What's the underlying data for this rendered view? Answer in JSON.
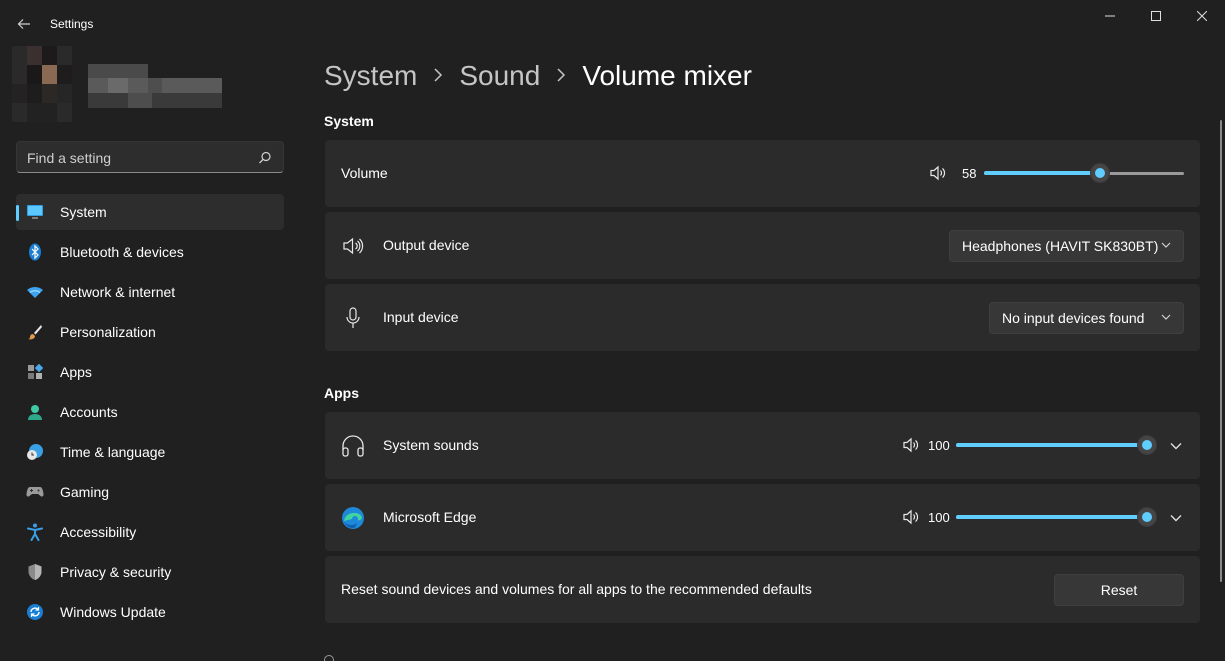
{
  "window": {
    "title": "Settings"
  },
  "search": {
    "placeholder": "Find a setting"
  },
  "sidebar": {
    "items": [
      {
        "label": "System",
        "icon": "monitor-icon",
        "active": true
      },
      {
        "label": "Bluetooth & devices",
        "icon": "bluetooth-icon"
      },
      {
        "label": "Network & internet",
        "icon": "wifi-icon"
      },
      {
        "label": "Personalization",
        "icon": "brush-icon"
      },
      {
        "label": "Apps",
        "icon": "apps-icon"
      },
      {
        "label": "Accounts",
        "icon": "person-icon"
      },
      {
        "label": "Time & language",
        "icon": "globe-clock-icon"
      },
      {
        "label": "Gaming",
        "icon": "gamepad-icon"
      },
      {
        "label": "Accessibility",
        "icon": "accessibility-icon"
      },
      {
        "label": "Privacy & security",
        "icon": "shield-icon"
      },
      {
        "label": "Windows Update",
        "icon": "update-icon"
      }
    ]
  },
  "breadcrumb": {
    "items": [
      "System",
      "Sound"
    ],
    "current": "Volume mixer"
  },
  "system_section": {
    "title": "System",
    "volume": {
      "label": "Volume",
      "value": "58",
      "level": 58
    },
    "output": {
      "label": "Output device",
      "selected": "Headphones (HAVIT SK830BT)"
    },
    "input": {
      "label": "Input device",
      "selected": "No input devices found"
    }
  },
  "apps_section": {
    "title": "Apps",
    "apps": [
      {
        "name": "System sounds",
        "icon": "headphones-icon",
        "value": "100",
        "level": 100
      },
      {
        "name": "Microsoft Edge",
        "icon": "edge-logo-icon",
        "value": "100",
        "level": 100
      }
    ]
  },
  "reset": {
    "description": "Reset sound devices and volumes for all apps to the recommended defaults",
    "button_label": "Reset"
  },
  "colors": {
    "accent": "#60cdff",
    "background": "#202020",
    "card": "#2b2b2b"
  }
}
